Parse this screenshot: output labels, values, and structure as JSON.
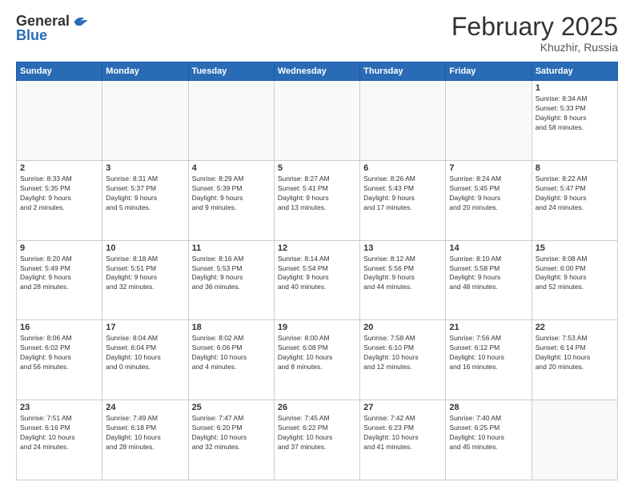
{
  "header": {
    "logo_general": "General",
    "logo_blue": "Blue",
    "month_title": "February 2025",
    "location": "Khuzhir, Russia"
  },
  "days_of_week": [
    "Sunday",
    "Monday",
    "Tuesday",
    "Wednesday",
    "Thursday",
    "Friday",
    "Saturday"
  ],
  "weeks": [
    [
      {
        "day": "",
        "info": ""
      },
      {
        "day": "",
        "info": ""
      },
      {
        "day": "",
        "info": ""
      },
      {
        "day": "",
        "info": ""
      },
      {
        "day": "",
        "info": ""
      },
      {
        "day": "",
        "info": ""
      },
      {
        "day": "1",
        "info": "Sunrise: 8:34 AM\nSunset: 5:33 PM\nDaylight: 8 hours\nand 58 minutes."
      }
    ],
    [
      {
        "day": "2",
        "info": "Sunrise: 8:33 AM\nSunset: 5:35 PM\nDaylight: 9 hours\nand 2 minutes."
      },
      {
        "day": "3",
        "info": "Sunrise: 8:31 AM\nSunset: 5:37 PM\nDaylight: 9 hours\nand 5 minutes."
      },
      {
        "day": "4",
        "info": "Sunrise: 8:29 AM\nSunset: 5:39 PM\nDaylight: 9 hours\nand 9 minutes."
      },
      {
        "day": "5",
        "info": "Sunrise: 8:27 AM\nSunset: 5:41 PM\nDaylight: 9 hours\nand 13 minutes."
      },
      {
        "day": "6",
        "info": "Sunrise: 8:26 AM\nSunset: 5:43 PM\nDaylight: 9 hours\nand 17 minutes."
      },
      {
        "day": "7",
        "info": "Sunrise: 8:24 AM\nSunset: 5:45 PM\nDaylight: 9 hours\nand 20 minutes."
      },
      {
        "day": "8",
        "info": "Sunrise: 8:22 AM\nSunset: 5:47 PM\nDaylight: 9 hours\nand 24 minutes."
      }
    ],
    [
      {
        "day": "9",
        "info": "Sunrise: 8:20 AM\nSunset: 5:49 PM\nDaylight: 9 hours\nand 28 minutes."
      },
      {
        "day": "10",
        "info": "Sunrise: 8:18 AM\nSunset: 5:51 PM\nDaylight: 9 hours\nand 32 minutes."
      },
      {
        "day": "11",
        "info": "Sunrise: 8:16 AM\nSunset: 5:53 PM\nDaylight: 9 hours\nand 36 minutes."
      },
      {
        "day": "12",
        "info": "Sunrise: 8:14 AM\nSunset: 5:54 PM\nDaylight: 9 hours\nand 40 minutes."
      },
      {
        "day": "13",
        "info": "Sunrise: 8:12 AM\nSunset: 5:56 PM\nDaylight: 9 hours\nand 44 minutes."
      },
      {
        "day": "14",
        "info": "Sunrise: 8:10 AM\nSunset: 5:58 PM\nDaylight: 9 hours\nand 48 minutes."
      },
      {
        "day": "15",
        "info": "Sunrise: 8:08 AM\nSunset: 6:00 PM\nDaylight: 9 hours\nand 52 minutes."
      }
    ],
    [
      {
        "day": "16",
        "info": "Sunrise: 8:06 AM\nSunset: 6:02 PM\nDaylight: 9 hours\nand 56 minutes."
      },
      {
        "day": "17",
        "info": "Sunrise: 8:04 AM\nSunset: 6:04 PM\nDaylight: 10 hours\nand 0 minutes."
      },
      {
        "day": "18",
        "info": "Sunrise: 8:02 AM\nSunset: 6:06 PM\nDaylight: 10 hours\nand 4 minutes."
      },
      {
        "day": "19",
        "info": "Sunrise: 8:00 AM\nSunset: 6:08 PM\nDaylight: 10 hours\nand 8 minutes."
      },
      {
        "day": "20",
        "info": "Sunrise: 7:58 AM\nSunset: 6:10 PM\nDaylight: 10 hours\nand 12 minutes."
      },
      {
        "day": "21",
        "info": "Sunrise: 7:56 AM\nSunset: 6:12 PM\nDaylight: 10 hours\nand 16 minutes."
      },
      {
        "day": "22",
        "info": "Sunrise: 7:53 AM\nSunset: 6:14 PM\nDaylight: 10 hours\nand 20 minutes."
      }
    ],
    [
      {
        "day": "23",
        "info": "Sunrise: 7:51 AM\nSunset: 6:16 PM\nDaylight: 10 hours\nand 24 minutes."
      },
      {
        "day": "24",
        "info": "Sunrise: 7:49 AM\nSunset: 6:18 PM\nDaylight: 10 hours\nand 28 minutes."
      },
      {
        "day": "25",
        "info": "Sunrise: 7:47 AM\nSunset: 6:20 PM\nDaylight: 10 hours\nand 32 minutes."
      },
      {
        "day": "26",
        "info": "Sunrise: 7:45 AM\nSunset: 6:22 PM\nDaylight: 10 hours\nand 37 minutes."
      },
      {
        "day": "27",
        "info": "Sunrise: 7:42 AM\nSunset: 6:23 PM\nDaylight: 10 hours\nand 41 minutes."
      },
      {
        "day": "28",
        "info": "Sunrise: 7:40 AM\nSunset: 6:25 PM\nDaylight: 10 hours\nand 45 minutes."
      },
      {
        "day": "",
        "info": ""
      }
    ]
  ]
}
